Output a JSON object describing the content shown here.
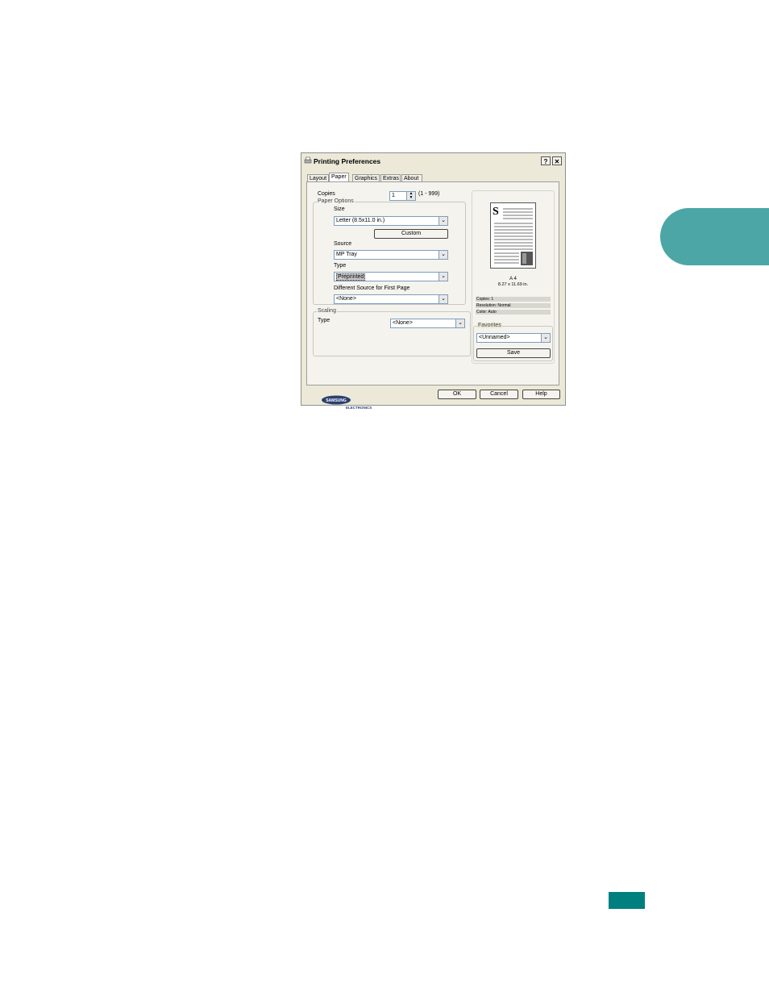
{
  "dialog": {
    "title": "Printing Preferences",
    "help_btn": "?",
    "close_btn": "✕",
    "tabs": [
      {
        "label": "Layout",
        "active": false
      },
      {
        "label": "Paper",
        "active": true
      },
      {
        "label": "Graphics",
        "active": false
      },
      {
        "label": "Extras",
        "active": false
      },
      {
        "label": "About",
        "active": false
      }
    ],
    "copies": {
      "label": "Copies",
      "value": "1",
      "range": "(1 - 999)"
    },
    "paper_options": {
      "group_label": "Paper Options",
      "size_label": "Size",
      "size_value": "Letter (8.5x11.0 in.)",
      "custom_button": "Custom",
      "source_label": "Source",
      "source_value": "MP Tray",
      "type_label": "Type",
      "type_value": "Preprinted",
      "first_page_label": "Different Source for First Page",
      "first_page_value": "<None>"
    },
    "scaling": {
      "group_label": "Scaling",
      "type_label": "Type",
      "type_value": "<None>"
    },
    "preview": {
      "letter": "S",
      "paper_name": "A 4",
      "paper_size": "8.27 x 11.69 in.",
      "copies": "Copies: 1",
      "resolution": "Resolution: Normal",
      "color": "Color: Auto"
    },
    "favorites": {
      "group_label": "Favorites",
      "value": "<Unnamed>",
      "save_button": "Save"
    },
    "logo": {
      "line1": "SAMSUNG",
      "line2": "ELECTRONICS"
    },
    "buttons": {
      "ok": "OK",
      "cancel": "Cancel",
      "help": "Help"
    }
  },
  "colors": {
    "accent": "#4ca6a6",
    "page_tag": "#007f7f"
  }
}
